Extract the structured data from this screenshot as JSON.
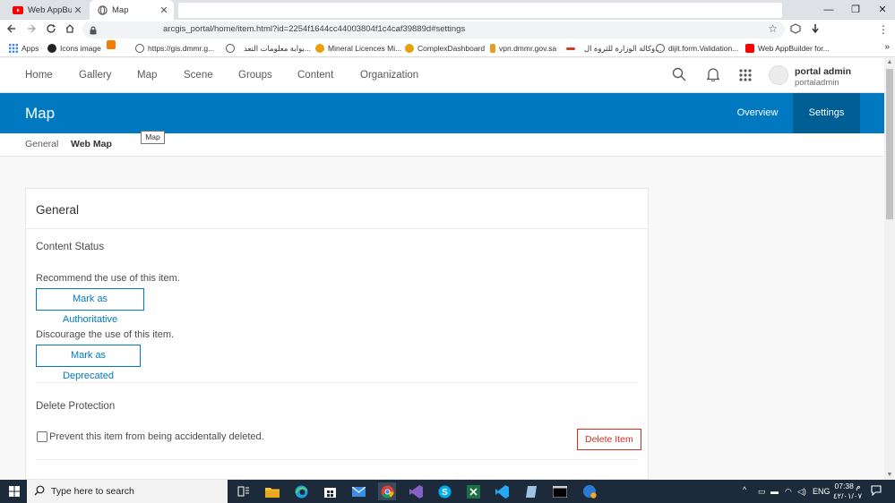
{
  "browser": {
    "tabs": [
      {
        "title": "Web AppBuildе",
        "icon": "youtube-icon",
        "active": false
      },
      {
        "title": "Map",
        "icon": "globe-icon",
        "active": true
      }
    ],
    "close_glyph": "✕",
    "window_controls": {
      "minimize": "—",
      "maximize": "❐",
      "close": "✕"
    },
    "url": "arcgis_portal/home/item.html?id=2254f1644cc44003804f1c4caf39889d#settings",
    "bookmarks": [
      {
        "label": "Apps",
        "icon": "apps-grid-icon",
        "color": "#4285f4"
      },
      {
        "label": "Icons image",
        "icon": "icons8-icon",
        "color": "#222222"
      },
      {
        "label": "",
        "icon": "blogger-icon",
        "color": "#f57d00"
      },
      {
        "label": "https://gis.dmmr.g...",
        "icon": "globe-icon",
        "color": "#555555"
      },
      {
        "label": "بوابة معلومات التعد...",
        "icon": "globe-icon",
        "color": "#555555"
      },
      {
        "label": "Mineral Licences Mi...",
        "icon": "arcgis-icon",
        "color": "#e8a00c"
      },
      {
        "label": "ComplexDashboard",
        "icon": "arcgis-icon",
        "color": "#e8a00c"
      },
      {
        "label": "vpn.dmmr.gov.sa",
        "icon": "vpn-icon",
        "color": "#e0a020"
      },
      {
        "label": "وكالة الوزارة للثروة ال...",
        "icon": "ministry-icon",
        "color": "#d04020"
      },
      {
        "label": "dijit.form.Validation...",
        "icon": "globe-icon",
        "color": "#555555"
      },
      {
        "label": "Web AppBuilder for...",
        "icon": "youtube-icon",
        "color": "#ff0000"
      }
    ],
    "more_glyph": "»"
  },
  "portal": {
    "nav": [
      "Home",
      "Gallery",
      "Map",
      "Scene",
      "Groups",
      "Content",
      "Organization"
    ],
    "user": {
      "name": "portal admin",
      "login": "portaladmin"
    },
    "page_title": "Map",
    "title_tabs": [
      {
        "label": "Overview",
        "active": false
      },
      {
        "label": "Settings",
        "active": true
      }
    ],
    "subnav": [
      {
        "label": "General",
        "active": false
      },
      {
        "label": "Web Map",
        "active": true
      }
    ],
    "tooltip": "Map",
    "card": {
      "heading": "General",
      "content_status": {
        "title": "Content Status",
        "recommend_label": "Recommend the use of this item.",
        "authoritative_button": "Mark as Authoritative",
        "discourage_label": "Discourage the use of this item.",
        "deprecated_button": "Mark as Deprecated"
      },
      "delete_protection": {
        "title": "Delete Protection",
        "checkbox_label": "Prevent this item from being accidentally deleted.",
        "checked": false,
        "delete_button": "Delete Item"
      }
    }
  },
  "taskbar": {
    "search_placeholder": "Type here to search",
    "apps": [
      "task-view-icon",
      "file-explorer-icon",
      "edge-icon",
      "store-icon",
      "mail-icon",
      "chrome-icon",
      "visual-studio-icon",
      "skype-icon",
      "excel-icon",
      "vscode-icon",
      "notepad-icon",
      "terminal-icon",
      "app-icon"
    ],
    "language": "ENG",
    "time": "07:38 م",
    "date": "٤٢/٠١/٠٧",
    "colors": {
      "accent": "#0079c1",
      "danger": "#d83020"
    }
  }
}
